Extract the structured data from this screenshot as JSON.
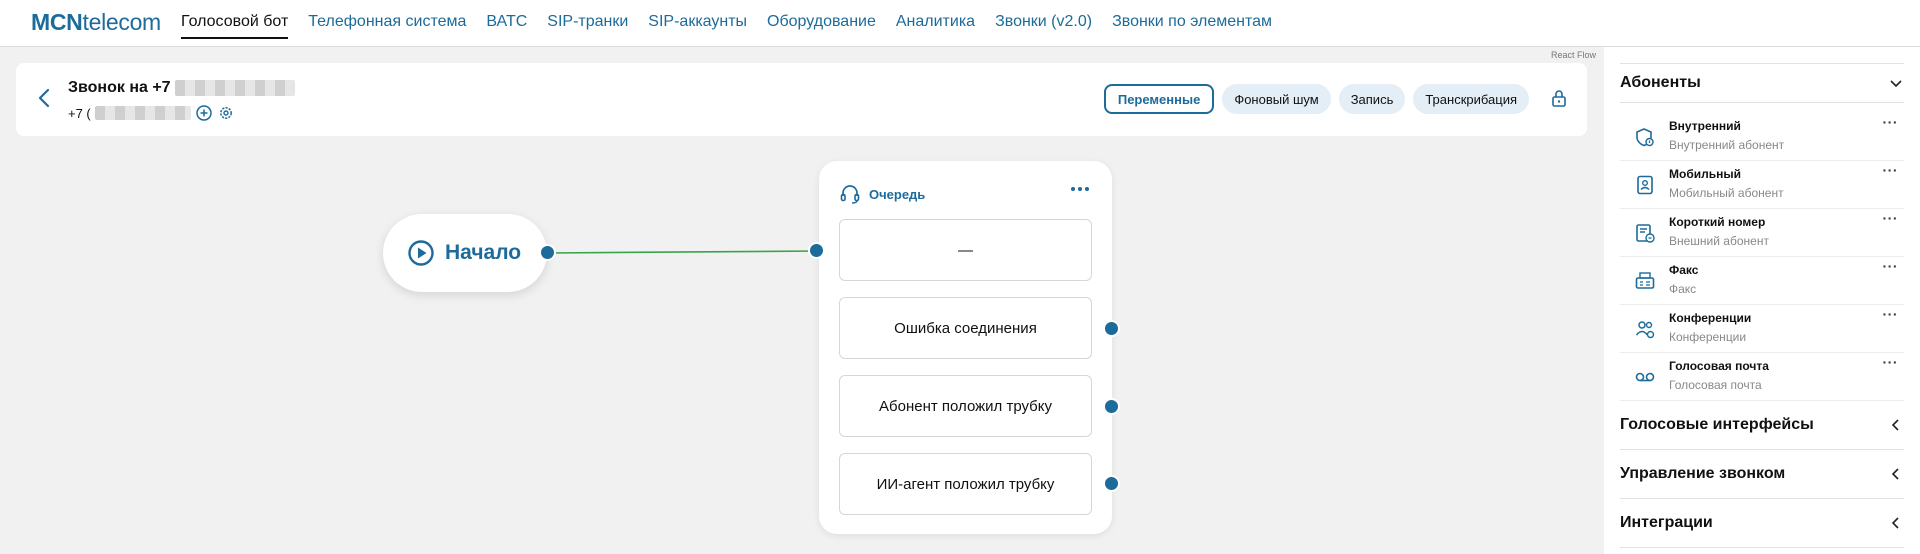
{
  "app": {
    "logo_bold": "MCN",
    "logo_rest": "telecom",
    "nav": [
      {
        "label": "Голосовой бот",
        "active": true
      },
      {
        "label": "Телефонная система"
      },
      {
        "label": "ВАТС"
      },
      {
        "label": "SIP-транки"
      },
      {
        "label": "SIP-аккаунты"
      },
      {
        "label": "Оборудование"
      },
      {
        "label": "Аналитика"
      },
      {
        "label": "Звонки (v2.0)"
      },
      {
        "label": "Звонки по элементам"
      }
    ]
  },
  "canvas": {
    "attribution": "React Flow"
  },
  "call": {
    "title_prefix": "Звонок на +7",
    "number_prefix": "+7 (",
    "buttons": {
      "variables": "Переменные",
      "noise": "Фоновый шум",
      "record": "Запись",
      "transcription": "Транскрибация"
    }
  },
  "flow": {
    "start_label": "Начало",
    "queue": {
      "title": "Очередь",
      "items": [
        "—",
        "Ошибка соединения",
        "Абонент положил трубку",
        "ИИ-агент положил трубку"
      ]
    }
  },
  "sidebar": {
    "sections": {
      "subscribers": "Абоненты",
      "voice": "Голосовые интерфейсы",
      "call_control": "Управление звонком",
      "integrations": "Интеграции"
    },
    "items": [
      {
        "title": "Внутренний",
        "sub": "Внутренний абонент",
        "icon": "internal-subscriber-icon"
      },
      {
        "title": "Мобильный",
        "sub": "Мобильный абонент",
        "icon": "mobile-subscriber-icon"
      },
      {
        "title": "Короткий номер",
        "sub": "Внешний абонент",
        "icon": "short-number-icon"
      },
      {
        "title": "Факс",
        "sub": "Факс",
        "icon": "fax-icon"
      },
      {
        "title": "Конференции",
        "sub": "Конференции",
        "icon": "conference-icon"
      },
      {
        "title": "Голосовая почта",
        "sub": "Голосовая почта",
        "icon": "voicemail-icon"
      }
    ],
    "more_glyph": "···"
  },
  "colors": {
    "accent": "#1c6b9a",
    "edge": "#3aa34a",
    "chip_bg": "#e4eef6",
    "canvas_bg": "#f1f1f1"
  }
}
